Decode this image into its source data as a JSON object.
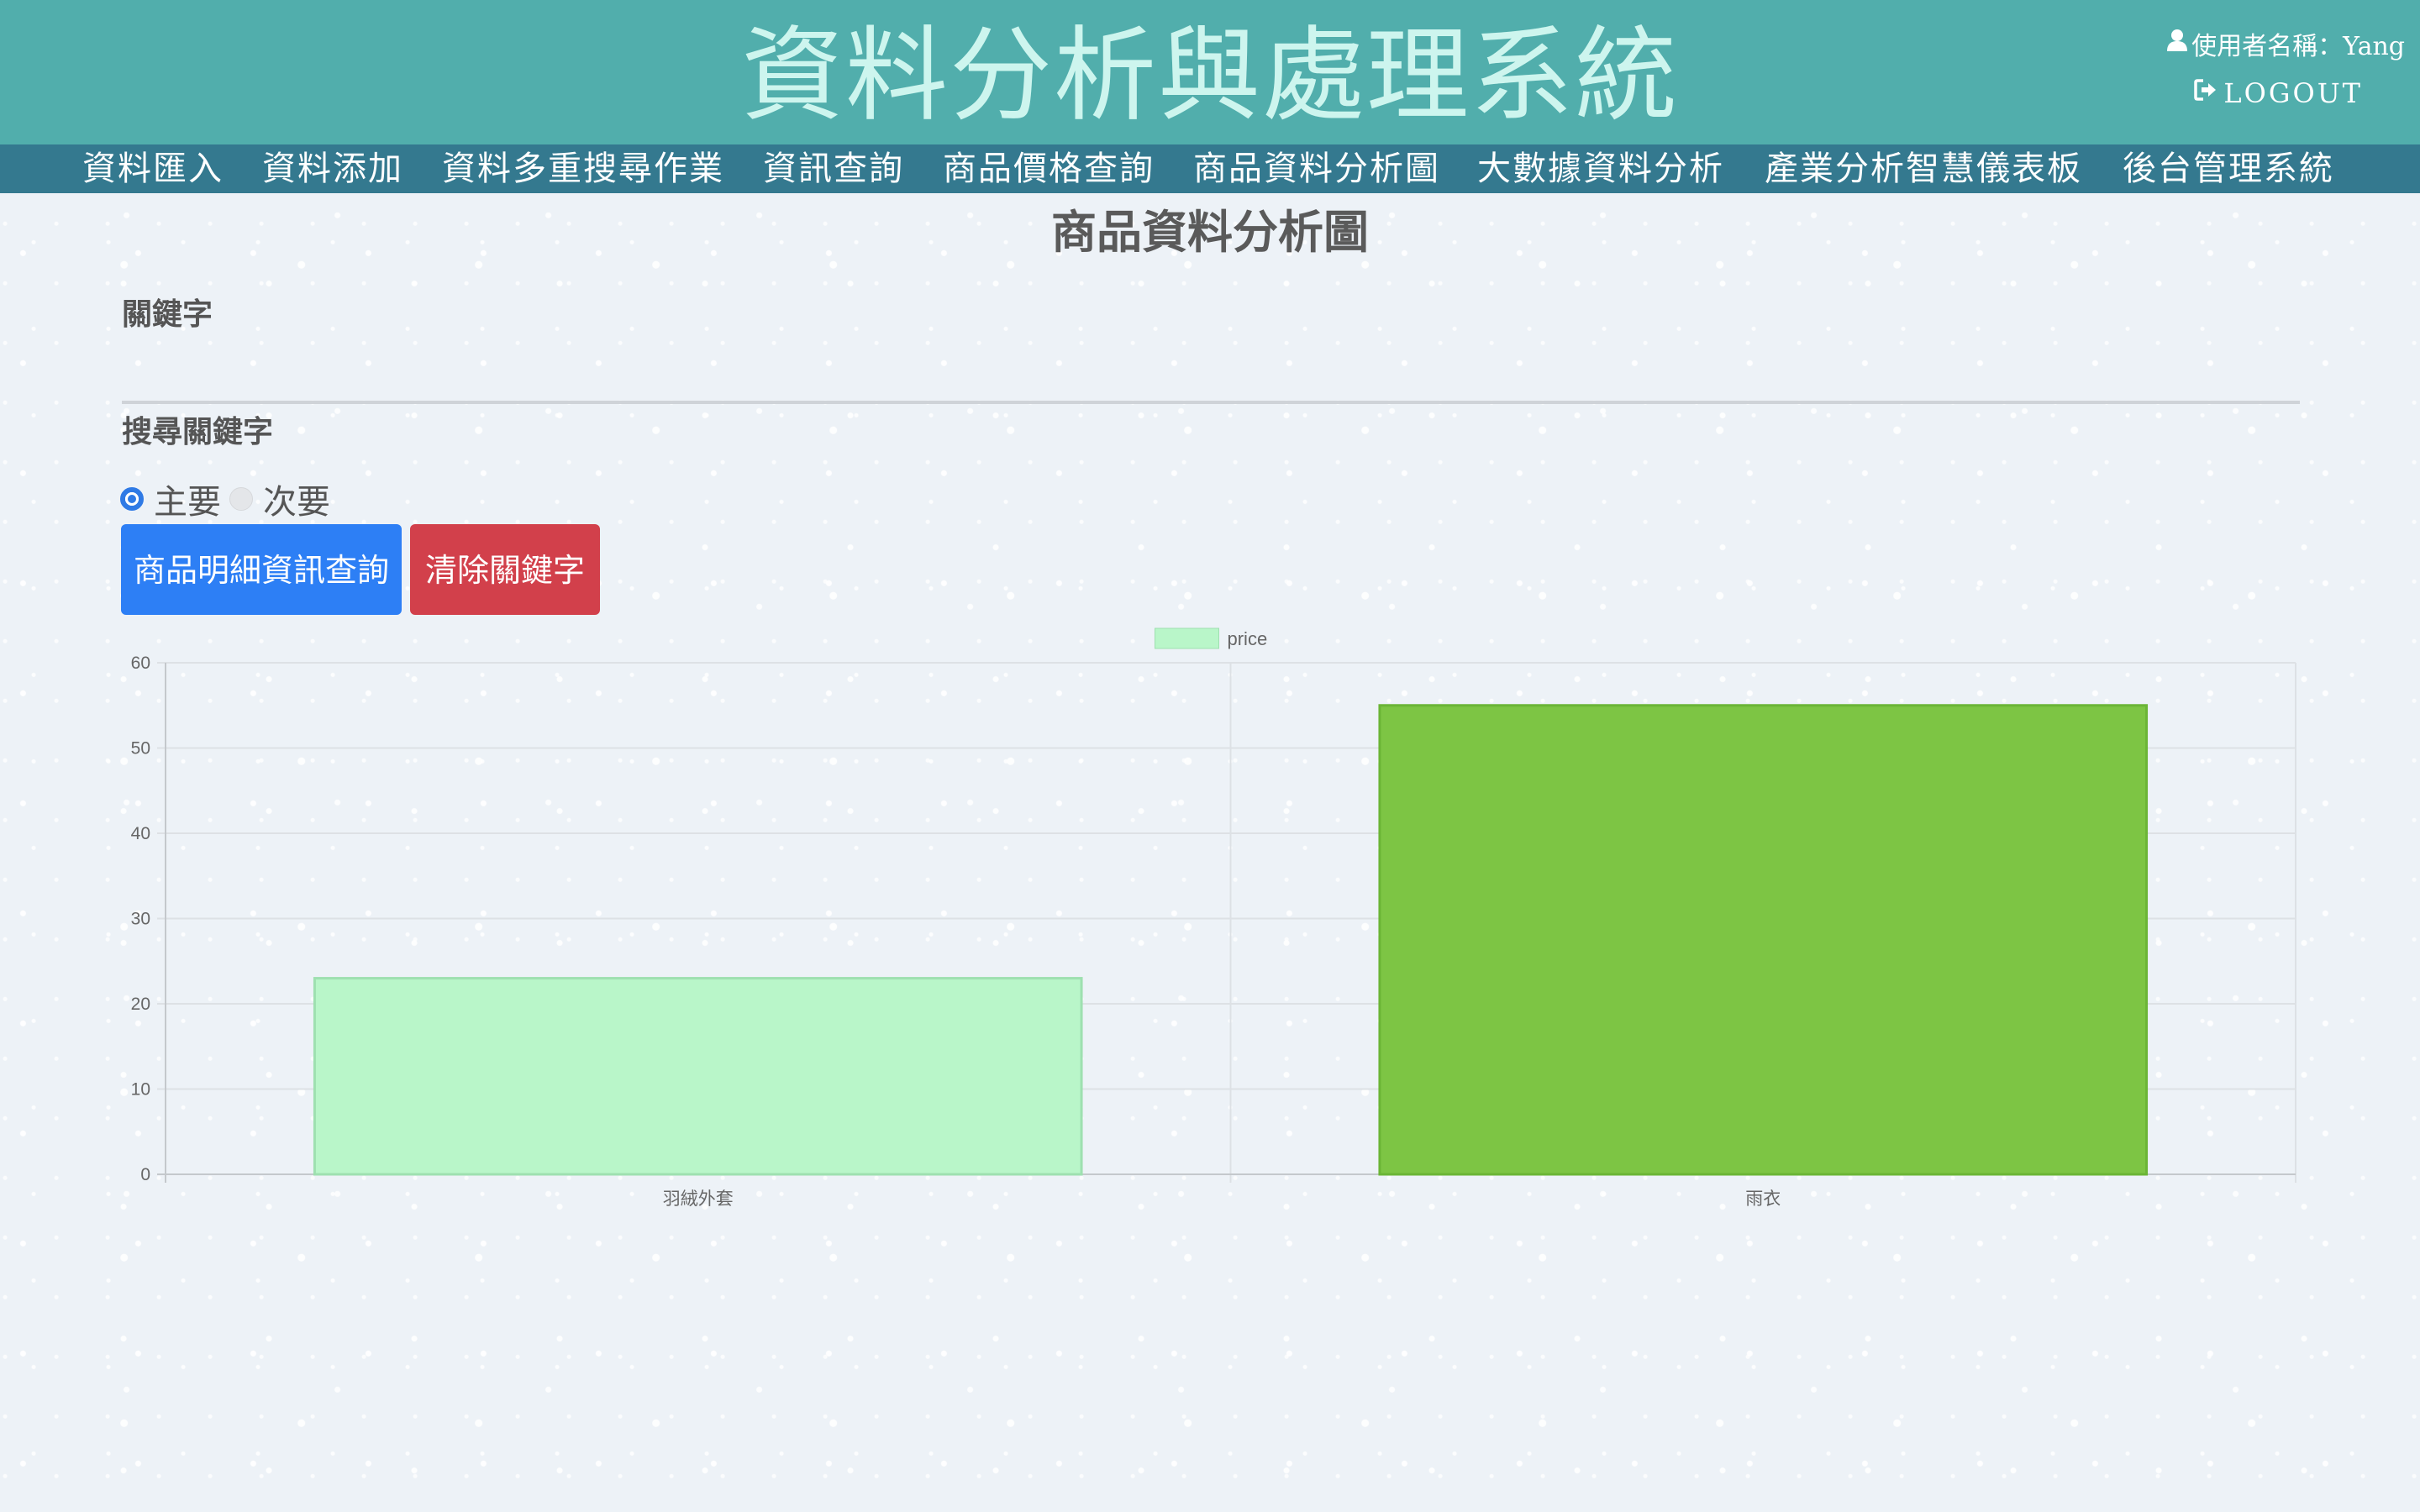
{
  "header": {
    "title": "資料分析與處理系統",
    "user_label": "使用者名稱：Yang",
    "logout_label": "LOGOUT"
  },
  "nav": {
    "items": [
      {
        "label": "資料匯入"
      },
      {
        "label": "資料添加"
      },
      {
        "label": "資料多重搜尋作業"
      },
      {
        "label": "資訊查詢"
      },
      {
        "label": "商品價格查詢"
      },
      {
        "label": "商品資料分析圖"
      },
      {
        "label": "大數據資料分析"
      },
      {
        "label": "產業分析智慧儀表板"
      },
      {
        "label": "後台管理系統"
      }
    ]
  },
  "page": {
    "title": "商品資料分析圖",
    "keyword_label": "關鍵字",
    "search_label": "搜尋關鍵字",
    "radio_primary": "主要",
    "radio_secondary": "次要",
    "btn_query": "商品明細資訊查詢",
    "btn_clear": "清除關鍵字"
  },
  "colors": {
    "header_bg": "#51aeac",
    "nav_bg": "#34798f",
    "primary_button": "#2d7ff5",
    "danger_button": "#d2404b",
    "bar_1": "#b9f6c9",
    "bar_2": "#7dc544"
  },
  "icons": {
    "user": "user-icon",
    "logout": "logout-icon"
  },
  "chart_data": {
    "type": "bar",
    "categories": [
      "羽絨外套",
      "雨衣"
    ],
    "series": [
      {
        "name": "price",
        "values": [
          23,
          55
        ]
      }
    ],
    "bar_colors": [
      "#b9f6c9",
      "#7dc544"
    ],
    "bar_border_colors": [
      "#9ee0b0",
      "#6bb536"
    ],
    "ylim": [
      0,
      60
    ],
    "yticks": [
      0,
      10,
      20,
      30,
      40,
      50,
      60
    ],
    "legend": "top-center",
    "grid": true
  }
}
